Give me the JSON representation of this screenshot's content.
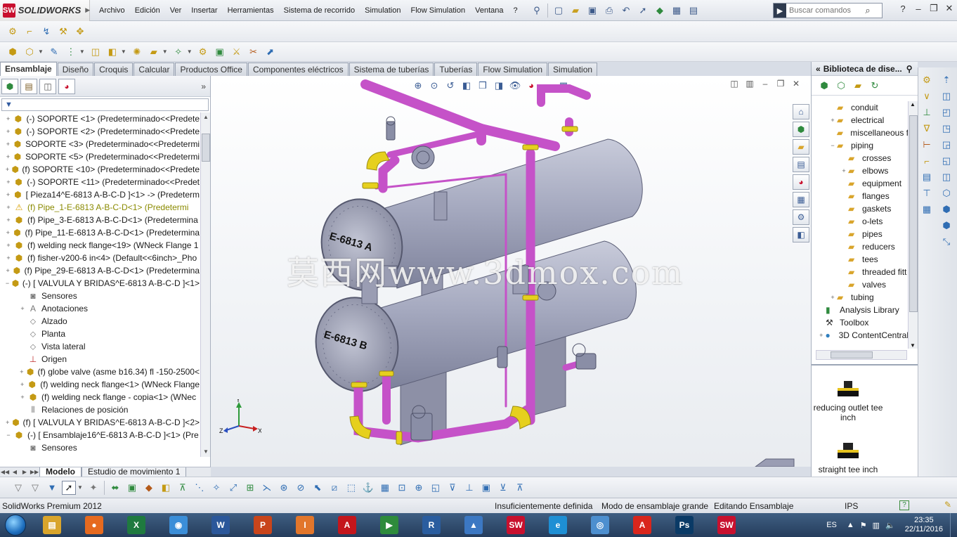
{
  "app": {
    "logo_mark": "SW",
    "logo_text": "SOLIDWORKS"
  },
  "menu": [
    "Archivo",
    "Edición",
    "Ver",
    "Insertar",
    "Herramientas",
    "Sistema de recorrido",
    "Simulation",
    "Flow Simulation",
    "Ventana",
    "?"
  ],
  "search": {
    "placeholder": "Buscar comandos"
  },
  "tabs": [
    "Ensamblaje",
    "Diseño",
    "Croquis",
    "Calcular",
    "Productos Office",
    "Componentes eléctricos",
    "Sistema de tuberías",
    "Tuberías",
    "Flow Simulation",
    "Simulation"
  ],
  "active_tab": "Ensamblaje",
  "filter_icon": "funnel-icon",
  "tree": [
    {
      "label": "(-) SOPORTE <1> (Predeterminado<<Predete",
      "icon": "assembly",
      "level": 0,
      "exp": "+"
    },
    {
      "label": "(-) SOPORTE <2> (Predeterminado<<Predete",
      "icon": "assembly",
      "level": 0,
      "exp": "+"
    },
    {
      "label": "SOPORTE <3> (Predeterminado<<Predetermi",
      "icon": "assembly",
      "level": 0,
      "exp": "+"
    },
    {
      "label": "SOPORTE <5> (Predeterminado<<Predetermi",
      "icon": "assembly",
      "level": 0,
      "exp": "+"
    },
    {
      "label": "(f) SOPORTE <10> (Predeterminado<<Predete",
      "icon": "assembly",
      "level": 0,
      "exp": "+"
    },
    {
      "label": "(-) SOPORTE <11> (Predeterminado<<Predet",
      "icon": "assembly",
      "level": 0,
      "exp": "+"
    },
    {
      "label": "[ Pieza14^E-6813 A-B-C-D ]<1> -> (Predeterm",
      "icon": "assembly",
      "level": 0,
      "exp": "+"
    },
    {
      "label": "(f) Pipe_1-E-6813 A-B-C-D<1> (Predetermi",
      "icon": "warn",
      "level": 0,
      "exp": "+",
      "warn": true
    },
    {
      "label": "(f) Pipe_3-E-6813 A-B-C-D<1> (Predetermina",
      "icon": "assembly",
      "level": 0,
      "exp": "+"
    },
    {
      "label": "(f) Pipe_11-E-6813 A-B-C-D<1> (Predetermina",
      "icon": "assembly",
      "level": 0,
      "exp": "+"
    },
    {
      "label": "(f) welding neck flange<19> (WNeck Flange 1",
      "icon": "assembly",
      "level": 0,
      "exp": "+"
    },
    {
      "label": "(f) fisher-v200-6 in<4> (Default<<6inch>_Pho",
      "icon": "assembly",
      "level": 0,
      "exp": "+"
    },
    {
      "label": "(f) Pipe_29-E-6813 A-B-C-D<1> (Predetermina",
      "icon": "assembly",
      "level": 0,
      "exp": "+"
    },
    {
      "label": "(-) [ VALVULA Y BRIDAS^E-6813 A-B-C-D ]<1>",
      "icon": "assembly",
      "level": 0,
      "exp": "−"
    },
    {
      "label": "Sensores",
      "icon": "sensor",
      "level": 1,
      "exp": ""
    },
    {
      "label": "Anotaciones",
      "icon": "annotation",
      "level": 1,
      "exp": "+"
    },
    {
      "label": "Alzado",
      "icon": "plane",
      "level": 1,
      "exp": ""
    },
    {
      "label": "Planta",
      "icon": "plane",
      "level": 1,
      "exp": ""
    },
    {
      "label": "Vista lateral",
      "icon": "plane",
      "level": 1,
      "exp": ""
    },
    {
      "label": "Origen",
      "icon": "origin",
      "level": 1,
      "exp": ""
    },
    {
      "label": "(f) globe valve (asme b16.34) fl -150-2500<",
      "icon": "assembly",
      "level": 1,
      "exp": "+"
    },
    {
      "label": "(f) welding neck flange<1> (WNeck Flange",
      "icon": "assembly",
      "level": 1,
      "exp": "+"
    },
    {
      "label": "(f) welding neck flange - copia<1> (WNec",
      "icon": "assembly",
      "level": 1,
      "exp": "+"
    },
    {
      "label": "Relaciones de posición",
      "icon": "mates",
      "level": 1,
      "exp": ""
    },
    {
      "label": "(f) [ VALVULA Y BRIDAS^E-6813 A-B-C-D ]<2>",
      "icon": "assembly",
      "level": 0,
      "exp": "+"
    },
    {
      "label": "(-) [ Ensamblaje16^E-6813 A-B-C-D ]<1> (Pre",
      "icon": "assembly",
      "level": 0,
      "exp": "−"
    },
    {
      "label": "Sensores",
      "icon": "sensor",
      "level": 1,
      "exp": ""
    }
  ],
  "viewport": {
    "watermark": "莫西网www.3dmox.com",
    "vessel_a": "E-6813 A",
    "vessel_b": "E-6813 B",
    "triad": {
      "x": "X",
      "y": "Y",
      "z": "Z"
    }
  },
  "library": {
    "title": "Biblioteca de dise...",
    "items": [
      {
        "label": "conduit",
        "level": 1,
        "exp": ""
      },
      {
        "label": "electrical",
        "level": 1,
        "exp": "+"
      },
      {
        "label": "miscellaneous f",
        "level": 1,
        "exp": ""
      },
      {
        "label": "piping",
        "level": 1,
        "exp": "−"
      },
      {
        "label": "crosses",
        "level": 2,
        "exp": ""
      },
      {
        "label": "elbows",
        "level": 2,
        "exp": "+"
      },
      {
        "label": "equipment",
        "level": 2,
        "exp": ""
      },
      {
        "label": "flanges",
        "level": 2,
        "exp": ""
      },
      {
        "label": "gaskets",
        "level": 2,
        "exp": ""
      },
      {
        "label": "o-lets",
        "level": 2,
        "exp": ""
      },
      {
        "label": "pipes",
        "level": 2,
        "exp": ""
      },
      {
        "label": "reducers",
        "level": 2,
        "exp": ""
      },
      {
        "label": "tees",
        "level": 2,
        "exp": ""
      },
      {
        "label": "threaded fitt",
        "level": 2,
        "exp": ""
      },
      {
        "label": "valves",
        "level": 2,
        "exp": ""
      },
      {
        "label": "tubing",
        "level": 1,
        "exp": "+"
      },
      {
        "label": "Analysis Library",
        "level": 0,
        "exp": "",
        "icon": "analysis"
      },
      {
        "label": "Toolbox",
        "level": 0,
        "exp": "",
        "icon": "toolbox"
      },
      {
        "label": "3D ContentCentral",
        "level": 0,
        "exp": "+",
        "icon": "globe"
      }
    ],
    "previews": [
      {
        "label": "reducing outlet tee inch"
      },
      {
        "label": "straight tee inch"
      }
    ]
  },
  "model_tabs": [
    "Modelo",
    "Estudio de movimiento 1"
  ],
  "status": {
    "product": "SolidWorks Premium 2012",
    "definition": "Insuficientemente definida",
    "mode": "Modo de ensamblaje grande",
    "editing": "Editando Ensamblaje",
    "units": "IPS"
  },
  "taskbar": {
    "apps": [
      {
        "name": "explorer",
        "glyph": "▤",
        "color": "#d9a52c"
      },
      {
        "name": "firefox",
        "glyph": "●",
        "color": "#e66a1f"
      },
      {
        "name": "excel",
        "glyph": "X",
        "color": "#1f7a3f"
      },
      {
        "name": "chrome",
        "glyph": "◉",
        "color": "#3b8ed8"
      },
      {
        "name": "word",
        "glyph": "W",
        "color": "#2b579a"
      },
      {
        "name": "powerpoint",
        "glyph": "P",
        "color": "#c9451b"
      },
      {
        "name": "inventor",
        "glyph": "I",
        "color": "#e2762b"
      },
      {
        "name": "autocad",
        "glyph": "A",
        "color": "#c4161c"
      },
      {
        "name": "project",
        "glyph": "▶",
        "color": "#2e8b3c"
      },
      {
        "name": "revit",
        "glyph": "R",
        "color": "#2a5d9f"
      },
      {
        "name": "autodesk-p",
        "glyph": "▲",
        "color": "#3c78c3"
      },
      {
        "name": "solidworks",
        "glyph": "SW",
        "color": "#c8102e"
      },
      {
        "name": "ie",
        "glyph": "e",
        "color": "#1e8fd4"
      },
      {
        "name": "network",
        "glyph": "◎",
        "color": "#4d8fcf"
      },
      {
        "name": "acrobat",
        "glyph": "A",
        "color": "#d9261c"
      },
      {
        "name": "photoshop",
        "glyph": "Ps",
        "color": "#0a3a66"
      },
      {
        "name": "solidworks-2",
        "glyph": "SW",
        "color": "#c8102e"
      }
    ],
    "lang": "ES",
    "time": "23:35",
    "date": "22/11/2016"
  },
  "colors": {
    "pipe": "#c552c8",
    "flange": "#e6d01e",
    "vessel": "#9ea2b8",
    "accent": "#c8102e"
  }
}
